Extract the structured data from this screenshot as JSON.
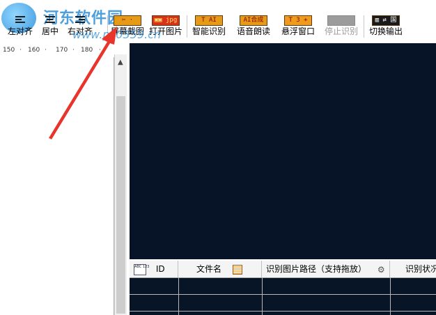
{
  "toolbar": {
    "buttons": [
      {
        "label": "左对齐",
        "icon": "align-left-icon"
      },
      {
        "label": "居中",
        "icon": "align-center-icon"
      },
      {
        "label": "右对齐",
        "icon": "align-right-icon"
      },
      {
        "label": "屏幕截图",
        "icon": "screenshot-icon",
        "icon_text": "✂ ·"
      },
      {
        "label": "打开图片",
        "icon": "open-image-icon",
        "icon_text": "▣▣ jpg"
      },
      {
        "label": "智能识别",
        "icon": "ocr-icon",
        "icon_text": "T AI OCR"
      },
      {
        "label": "语音朗读",
        "icon": "speech-icon",
        "icon_text": "AI合成"
      },
      {
        "label": "悬浮窗口",
        "icon": "float-window-icon",
        "icon_text": "T 3 +"
      },
      {
        "label": "停止识别",
        "icon": "stop-icon",
        "icon_text": "",
        "disabled": true
      },
      {
        "label": "切换输出",
        "icon": "switch-output-icon",
        "icon_text": "▥ ⇄ 国"
      }
    ]
  },
  "watermark": {
    "site": "河东软件园",
    "url": "www.pc0359.cn"
  },
  "ruler": {
    "ticks": [
      "150",
      "·",
      "160",
      "·",
      "170",
      "·",
      "180",
      "·"
    ]
  },
  "grid": {
    "columns": [
      {
        "label": "ID",
        "icon": "abc-123-icon",
        "icon_text": "ABC 123"
      },
      {
        "label": "文件名",
        "icon": "file-grid-icon"
      },
      {
        "label": "识别图片路径（支持拖放）",
        "icon": "link-icon"
      },
      {
        "label": "识别状况"
      }
    ]
  },
  "colors": {
    "preview_bg": "#071427",
    "arrow": "#e8342a",
    "watermark": "#2e8fd8"
  }
}
